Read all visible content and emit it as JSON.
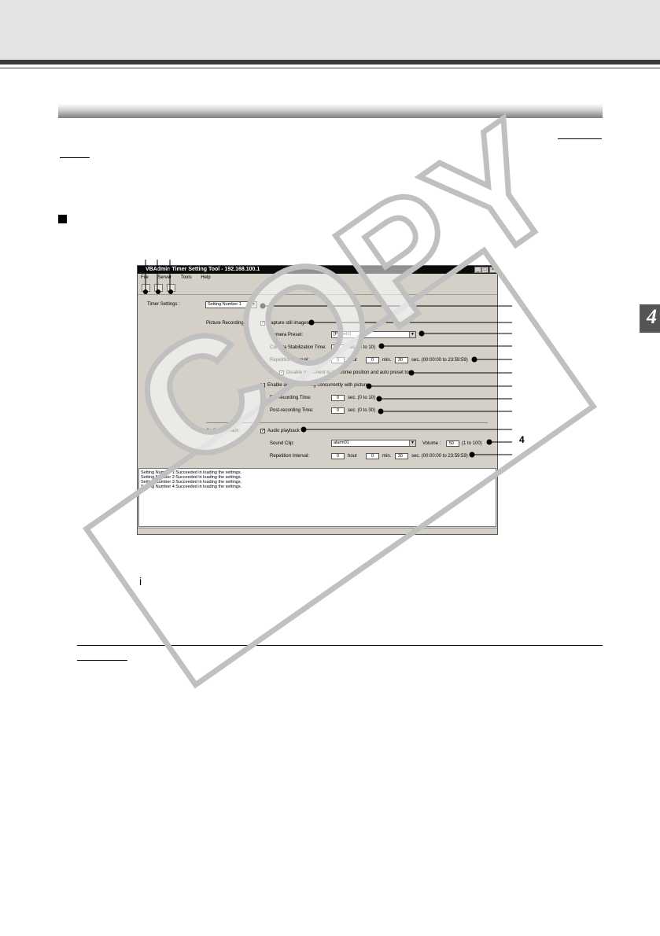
{
  "chapter_number": "4",
  "callout_number": "4",
  "stray_mark": "i",
  "window": {
    "title": "VBAdmin Timer Setting Tool - 192.168.100.1",
    "menu": [
      "File",
      "Server",
      "Tools",
      "Help"
    ],
    "timer_settings_label": "Timer Settings :",
    "timer_settings_value": "Setting Number 1",
    "picture_recording_label": "Picture Recording:",
    "capture_still_images": "Capture still images",
    "camera_preset_label": "Camera Preset:",
    "camera_preset_value": "[Preset1]",
    "stabilization_label": "Camera Stabilization Time:",
    "stabilization_value": "0",
    "stabilization_range": "sec. (0 to 10)",
    "repetition_label": "Repetition Interval:",
    "rep_hour": "0",
    "hour": "hour",
    "rep_min": "0",
    "min": "min.",
    "rep_sec": "30",
    "rep_sec_range": "sec. (00:00:00 to 23:59:59)",
    "disable_movement": "Disable movement to the home position and auto preset tour",
    "enable_audio": "Enable audio recording concurrently with picture",
    "pre_label": "Pre-recording Time:",
    "pre_value": "0",
    "pre_range": "sec. (0 to 10)",
    "post_label": "Post-recording Time:",
    "post_value": "0",
    "post_range": "sec. (0 to 30)",
    "audio_playback_label": "Audio Playback:",
    "audio_playback_check": "Audio playback",
    "sound_clip_label": "Sound Clip:",
    "sound_clip_value": "alarm01",
    "volume_label": "Volume :",
    "volume_value": "50",
    "volume_range": "(1 to 100)",
    "rep2_label": "Repetition Interval:",
    "rep2_hour": "0",
    "rep2_min": "0",
    "rep2_sec": "30",
    "rep2_range": "sec. (00:00:00 to 23:59:59)",
    "log": [
      "Setting Number 1:Succeeded in loading the settings.",
      "Setting Number 2:Succeeded in loading the settings.",
      "Setting Number 3:Succeeded in loading the settings.",
      "Setting Number 4:Succeeded in loading the settings."
    ]
  },
  "watermark": "COPY"
}
